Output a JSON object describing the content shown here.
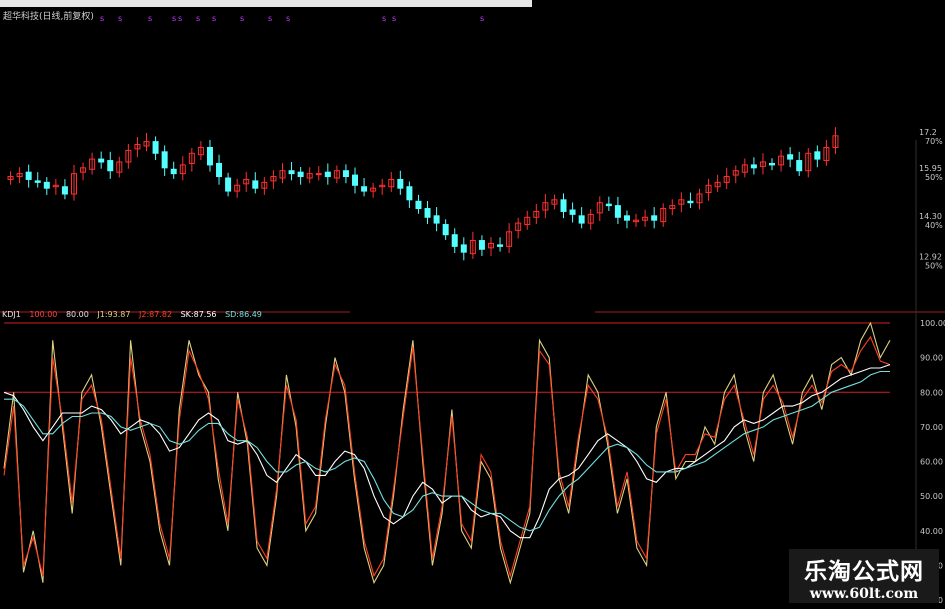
{
  "window": {
    "title": "超华科技(日线,前复权)",
    "signal_marks": [
      "s",
      "s",
      "s",
      "s",
      "s",
      "s",
      "s",
      "s",
      "s",
      "s",
      "s",
      "s",
      "s"
    ]
  },
  "watermark": {
    "name": "乐淘公式网",
    "url": "www.60lt.com"
  },
  "kdj_header": {
    "name": "KDJ1",
    "params": "100.00",
    "v2": "80.00",
    "j1": "J1:93.87",
    "j2": "J2:87.82",
    "sk": "SK:87.56",
    "sd": "SD:86.49"
  },
  "colors": {
    "up_candle": "#ff3030",
    "down_candle": "#55ffff",
    "line_j": "#e0d080",
    "line_k": "#ff4020",
    "line_sk": "#ffffff",
    "line_sd": "#70e0e0",
    "level_line": "#d02020",
    "divider": "#a02020"
  },
  "chart_data": [
    {
      "type": "candlestick",
      "title": "超华科技(日线,前复权)",
      "y_axis_labels": [
        {
          "value": 17.2,
          "text": "17.2",
          "pct": "70%"
        },
        {
          "value": 15.95,
          "text": "15.95",
          "pct": "50%"
        },
        {
          "value": 14.3,
          "text": "14.30",
          "pct": "40%"
        },
        {
          "value": 12.92,
          "text": "12.92",
          "pct": "50%"
        }
      ],
      "ylim": [
        11.9,
        17.4
      ],
      "closes": [
        15.8,
        15.9,
        15.7,
        15.6,
        15.4,
        15.5,
        15.2,
        15.9,
        16.1,
        16.4,
        16.3,
        16.0,
        16.3,
        16.7,
        16.9,
        17.0,
        16.6,
        16.1,
        15.9,
        16.2,
        16.6,
        16.8,
        16.2,
        15.8,
        15.3,
        15.5,
        15.7,
        15.4,
        15.6,
        15.8,
        16.0,
        15.9,
        15.8,
        15.9,
        15.9,
        15.8,
        16.0,
        15.8,
        15.5,
        15.3,
        15.4,
        15.5,
        15.7,
        15.4,
        15.0,
        14.7,
        14.4,
        14.2,
        13.8,
        13.4,
        13.2,
        13.6,
        13.3,
        13.5,
        13.4,
        13.9,
        14.2,
        14.4,
        14.6,
        14.9,
        15.0,
        14.6,
        14.5,
        14.2,
        14.5,
        14.9,
        14.8,
        14.4,
        14.3,
        14.3,
        14.4,
        14.3,
        14.7,
        14.8,
        15.0,
        14.9,
        15.2,
        15.5,
        15.6,
        15.8,
        16.0,
        16.2,
        16.1,
        16.3,
        16.2,
        16.5,
        16.4,
        16.0,
        16.6,
        16.4,
        16.8,
        17.2
      ],
      "note": "approximate daily closes read from the chart; each candle opens near the prior close"
    },
    {
      "type": "line",
      "title": "KDJ1",
      "ylim": [
        20,
        100
      ],
      "y_ticks": [
        100,
        90,
        80,
        70,
        60,
        50,
        40,
        30,
        20
      ],
      "level_lines": [
        100,
        80
      ],
      "series": [
        {
          "name": "J1",
          "color": "#e0d080",
          "values": [
            58,
            80,
            28,
            40,
            25,
            95,
            70,
            45,
            80,
            85,
            70,
            50,
            30,
            95,
            70,
            60,
            40,
            30,
            75,
            95,
            85,
            80,
            55,
            40,
            80,
            65,
            35,
            30,
            50,
            85,
            70,
            40,
            45,
            70,
            90,
            80,
            55,
            35,
            25,
            30,
            50,
            75,
            95,
            60,
            30,
            45,
            75,
            40,
            35,
            60,
            55,
            35,
            25,
            35,
            45,
            95,
            90,
            55,
            45,
            65,
            85,
            80,
            65,
            45,
            55,
            35,
            30,
            70,
            80,
            55,
            60,
            60,
            70,
            65,
            80,
            85,
            70,
            60,
            80,
            85,
            75,
            65,
            80,
            85,
            75,
            88,
            90,
            85,
            95,
            100,
            90,
            95
          ]
        },
        {
          "name": "J2",
          "color": "#ff4020",
          "values": [
            56,
            76,
            30,
            38,
            27,
            90,
            72,
            48,
            78,
            82,
            72,
            52,
            32,
            90,
            72,
            62,
            42,
            32,
            72,
            92,
            86,
            78,
            58,
            42,
            78,
            67,
            37,
            32,
            52,
            82,
            72,
            42,
            47,
            72,
            88,
            82,
            57,
            37,
            27,
            32,
            52,
            73,
            93,
            62,
            32,
            47,
            73,
            42,
            37,
            62,
            57,
            37,
            27,
            37,
            47,
            92,
            88,
            57,
            47,
            67,
            82,
            78,
            67,
            47,
            57,
            37,
            32,
            68,
            78,
            57,
            62,
            62,
            68,
            67,
            78,
            82,
            72,
            62,
            78,
            82,
            77,
            67,
            78,
            82,
            77,
            86,
            88,
            86,
            92,
            96,
            89,
            88
          ]
        },
        {
          "name": "SK",
          "color": "#ffffff",
          "values": [
            80,
            79,
            75,
            70,
            66,
            70,
            74,
            74,
            74,
            76,
            75,
            72,
            68,
            70,
            72,
            71,
            68,
            63,
            64,
            68,
            72,
            74,
            72,
            66,
            65,
            66,
            62,
            56,
            54,
            58,
            62,
            60,
            56,
            56,
            60,
            63,
            62,
            58,
            50,
            44,
            42,
            44,
            50,
            54,
            52,
            48,
            50,
            50,
            46,
            44,
            45,
            44,
            40,
            38,
            38,
            44,
            52,
            55,
            56,
            58,
            62,
            66,
            68,
            66,
            64,
            60,
            55,
            54,
            57,
            58,
            58,
            60,
            62,
            64,
            66,
            70,
            72,
            71,
            72,
            74,
            76,
            76,
            77,
            79,
            80,
            82,
            84,
            85,
            86,
            87,
            87,
            88
          ]
        },
        {
          "name": "SD",
          "color": "#70e0e0",
          "values": [
            78,
            78,
            76,
            72,
            68,
            68,
            71,
            73,
            73,
            74,
            74,
            73,
            70,
            69,
            70,
            71,
            70,
            66,
            65,
            66,
            69,
            71,
            71,
            68,
            66,
            66,
            64,
            60,
            57,
            57,
            59,
            60,
            58,
            57,
            58,
            60,
            61,
            60,
            55,
            49,
            45,
            44,
            46,
            50,
            51,
            50,
            50,
            50,
            48,
            46,
            45,
            45,
            43,
            41,
            40,
            41,
            46,
            50,
            53,
            55,
            58,
            61,
            64,
            65,
            64,
            62,
            59,
            57,
            57,
            57,
            58,
            59,
            60,
            62,
            64,
            66,
            68,
            69,
            70,
            72,
            73,
            74,
            75,
            76,
            78,
            80,
            81,
            82,
            83,
            85,
            86,
            86
          ]
        }
      ]
    }
  ]
}
